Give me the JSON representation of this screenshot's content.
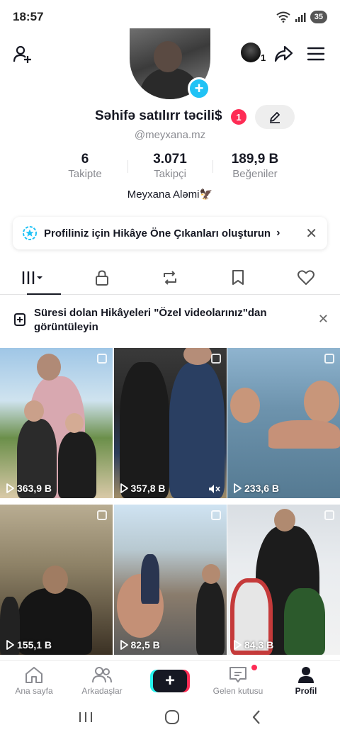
{
  "status_bar": {
    "time": "18:57",
    "battery": "35"
  },
  "profile": {
    "name": "Səhifə satılırr təcili$",
    "name_badge": "1",
    "handle": "@meyxana.mz",
    "top_avatar_count": "1",
    "bio": "Meyxana Aləmi🦅"
  },
  "stats": [
    {
      "value": "6",
      "label": "Takipte"
    },
    {
      "value": "3.071",
      "label": "Takipçi"
    },
    {
      "value": "189,9 B",
      "label": "Beğeniler"
    }
  ],
  "banner": {
    "text": "Profiliniz için Hikâye Öne Çıkanları oluşturun",
    "chevron": "›",
    "close": "✕"
  },
  "tabs": [
    {
      "name": "videos",
      "icon": "grid-bars-icon"
    },
    {
      "name": "private",
      "icon": "lock-icon"
    },
    {
      "name": "reposts",
      "icon": "repost-icon"
    },
    {
      "name": "favorites",
      "icon": "bookmark-icon"
    },
    {
      "name": "liked",
      "icon": "heart-icon"
    }
  ],
  "notice": {
    "text": "Süresi dolan Hikâyeleri \"Özel videolarınız\"dan görüntüleyin",
    "close": "✕"
  },
  "videos": [
    {
      "views": "363,9 B"
    },
    {
      "views": "357,8 B",
      "muted": true
    },
    {
      "views": "233,6 B"
    },
    {
      "views": "155,1 B"
    },
    {
      "views": "82,5 B"
    },
    {
      "views": "84,3 B"
    }
  ],
  "bottom_nav": [
    {
      "label": "Ana sayfa",
      "icon": "home-icon"
    },
    {
      "label": "Arkadaşlar",
      "icon": "friends-icon"
    },
    {
      "label": "",
      "icon": "create-icon"
    },
    {
      "label": "Gelen kutusu",
      "icon": "inbox-icon",
      "dot": true
    },
    {
      "label": "Profil",
      "icon": "profile-icon",
      "active": true
    }
  ],
  "colors": {
    "accent_red": "#fe2c55",
    "accent_cyan": "#25f4ee",
    "plus_blue": "#20c2f5",
    "text": "#161823",
    "muted": "#8a8b91"
  }
}
